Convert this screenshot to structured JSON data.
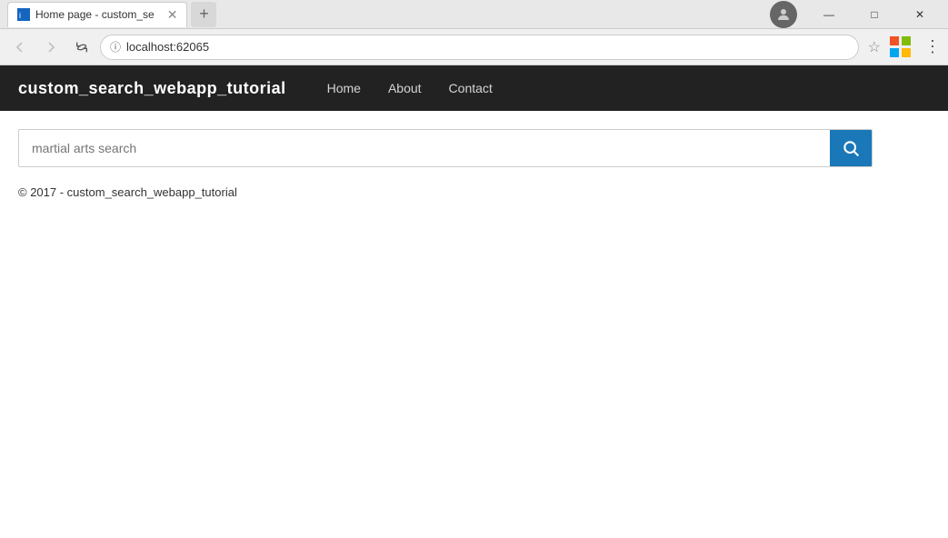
{
  "browser": {
    "tab_title": "Home page - custom_se",
    "url": "localhost:62065",
    "profile_icon": "👤"
  },
  "navbar": {
    "brand": "custom_search_webapp_tutorial",
    "links": [
      {
        "label": "Home",
        "id": "home"
      },
      {
        "label": "About",
        "id": "about"
      },
      {
        "label": "Contact",
        "id": "contact"
      }
    ]
  },
  "search": {
    "placeholder": "martial arts search",
    "button_icon": "🔍"
  },
  "footer": {
    "text": "© 2017 - custom_search_webapp_tutorial"
  },
  "icons": {
    "back": "‹",
    "forward": "›",
    "refresh": "↻",
    "lock": "ⓘ",
    "star": "☆",
    "more": "⋮",
    "minimize": "—",
    "maximize": "□",
    "close": "✕",
    "search": "🔍"
  }
}
